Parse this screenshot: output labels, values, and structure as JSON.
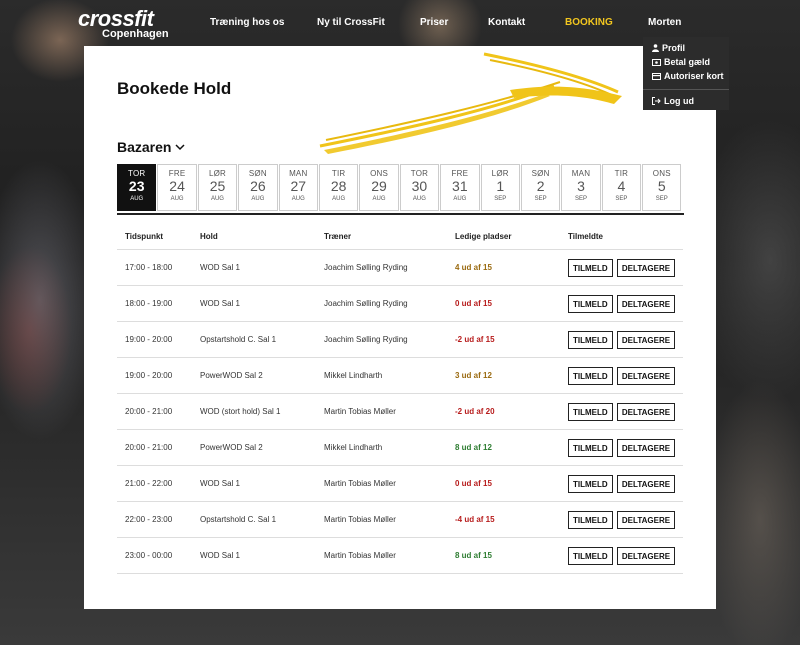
{
  "logo": {
    "line1": "crossfit",
    "line2": "Copenhagen"
  },
  "nav": {
    "items": [
      {
        "label": "Træning hos os",
        "active": false
      },
      {
        "label": "Ny til CrossFit",
        "active": false
      },
      {
        "label": "Priser",
        "active": false
      },
      {
        "label": "Kontakt",
        "active": false
      },
      {
        "label": "BOOKING",
        "active": true
      },
      {
        "label": "Morten",
        "active": false
      }
    ]
  },
  "user_menu": {
    "items": [
      {
        "label": "Profil",
        "icon": "user-icon"
      },
      {
        "label": "Betal gæld",
        "icon": "money-icon"
      },
      {
        "label": "Autoriser kort",
        "icon": "credit-card-icon"
      },
      {
        "label": "Log ud",
        "icon": "logout-icon"
      }
    ]
  },
  "page": {
    "title": "Bookede Hold",
    "location": "Bazaren"
  },
  "dates": [
    {
      "weekday": "TOR",
      "day": "23",
      "month": "AUG",
      "selected": true
    },
    {
      "weekday": "FRE",
      "day": "24",
      "month": "AUG",
      "selected": false
    },
    {
      "weekday": "LØR",
      "day": "25",
      "month": "AUG",
      "selected": false
    },
    {
      "weekday": "SØN",
      "day": "26",
      "month": "AUG",
      "selected": false
    },
    {
      "weekday": "MAN",
      "day": "27",
      "month": "AUG",
      "selected": false
    },
    {
      "weekday": "TIR",
      "day": "28",
      "month": "AUG",
      "selected": false
    },
    {
      "weekday": "ONS",
      "day": "29",
      "month": "AUG",
      "selected": false
    },
    {
      "weekday": "TOR",
      "day": "30",
      "month": "AUG",
      "selected": false
    },
    {
      "weekday": "FRE",
      "day": "31",
      "month": "AUG",
      "selected": false
    },
    {
      "weekday": "LØR",
      "day": "1",
      "month": "SEP",
      "selected": false
    },
    {
      "weekday": "SØN",
      "day": "2",
      "month": "SEP",
      "selected": false
    },
    {
      "weekday": "MAN",
      "day": "3",
      "month": "SEP",
      "selected": false
    },
    {
      "weekday": "TIR",
      "day": "4",
      "month": "SEP",
      "selected": false
    },
    {
      "weekday": "ONS",
      "day": "5",
      "month": "SEP",
      "selected": false
    }
  ],
  "table": {
    "headers": [
      "Tidspunkt",
      "Hold",
      "Træner",
      "Ledige pladser",
      "Tilmeldte"
    ],
    "register_label": "TILMELD",
    "participants_label": "DELTAGERE",
    "rows": [
      {
        "time": "17:00 - 18:00",
        "class": "WOD Sal 1",
        "trainer": "Joachim Sølling Ryding",
        "spots": "4 ud af 15",
        "status": "orange"
      },
      {
        "time": "18:00 - 19:00",
        "class": "WOD Sal 1",
        "trainer": "Joachim Sølling Ryding",
        "spots": "0 ud af 15",
        "status": "red"
      },
      {
        "time": "19:00 - 20:00",
        "class": "Opstartshold C. Sal 1",
        "trainer": "Joachim Sølling Ryding",
        "spots": "-2 ud af 15",
        "status": "red"
      },
      {
        "time": "19:00 - 20:00",
        "class": "PowerWOD Sal 2",
        "trainer": "Mikkel Lindharth",
        "spots": "3 ud af 12",
        "status": "orange"
      },
      {
        "time": "20:00 - 21:00",
        "class": "WOD (stort hold) Sal 1",
        "trainer": "Martin Tobias Møller",
        "spots": "-2 ud af 20",
        "status": "red"
      },
      {
        "time": "20:00 - 21:00",
        "class": "PowerWOD Sal 2",
        "trainer": "Mikkel Lindharth",
        "spots": "8 ud af 12",
        "status": "green"
      },
      {
        "time": "21:00 - 22:00",
        "class": "WOD Sal 1",
        "trainer": "Martin Tobias Møller",
        "spots": "0 ud af 15",
        "status": "red"
      },
      {
        "time": "22:00 - 23:00",
        "class": "Opstartshold C. Sal 1",
        "trainer": "Martin Tobias Møller",
        "spots": "-4 ud af 15",
        "status": "red"
      },
      {
        "time": "23:00 - 00:00",
        "class": "WOD Sal 1",
        "trainer": "Martin Tobias Møller",
        "spots": "8 ud af 15",
        "status": "green"
      }
    ]
  },
  "colors": {
    "accent": "#f2c61f",
    "arrow": "#f0c419",
    "orange": "#9a6a10",
    "red": "#b71c1c",
    "green": "#2e7d32"
  }
}
